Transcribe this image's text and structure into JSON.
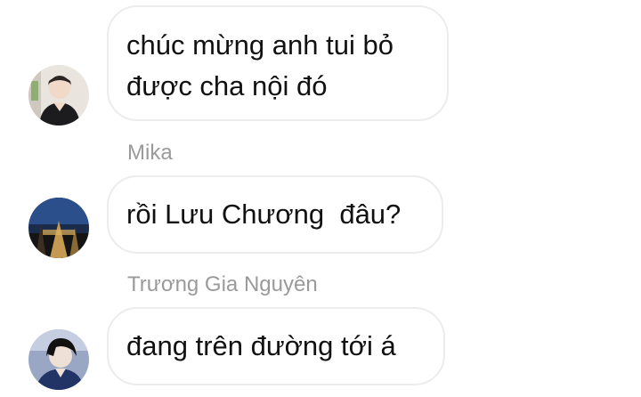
{
  "messages": [
    {
      "sender": "",
      "text": "chúc mừng anh tui bỏ\nđược cha nội đó",
      "avatar_icon": "user-avatar-photo"
    },
    {
      "sender": "Mika",
      "text": "rồi Lưu Chương  đâu?",
      "avatar_icon": "user-avatar-photo"
    },
    {
      "sender": "Trương Gia Nguyên",
      "text": "đang trên đường tới á",
      "avatar_icon": "user-avatar-photo"
    }
  ],
  "colors": {
    "background": "#ffffff",
    "bubble_border": "#ececec",
    "sender_text": "#9a9a9a",
    "message_text": "#111111"
  }
}
